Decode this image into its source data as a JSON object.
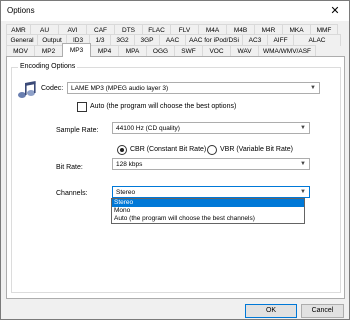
{
  "window": {
    "title": "Options",
    "close_glyph": "✕"
  },
  "tabs_row1": [
    "AMR",
    "AU",
    "AVI",
    "CAF",
    "DTS",
    "FLAC",
    "FLV",
    "M4A",
    "M4B",
    "M4R",
    "MKA",
    "MMF"
  ],
  "tabs_row2": [
    "General",
    "Output",
    "ID3",
    "1/3",
    "3G2",
    "3GP",
    "AAC",
    "AAC for iPod/DSi",
    "AC3",
    "AIFF",
    "ALAC"
  ],
  "tabs_row3": [
    "MOV",
    "MP2",
    "MP3",
    "MP4",
    "MPA",
    "OGG",
    "SWF",
    "VOC",
    "WAV",
    "WMA/WMV/ASF"
  ],
  "active_tab": "MP3",
  "encoding": {
    "group_label": "Encoding Options",
    "codec_label": "Codec:",
    "codec_value": "LAME MP3 (MPEG audio layer 3)",
    "auto_checkbox_label": "Auto (the program will choose the best options)",
    "sample_rate_label": "Sample Rate:",
    "sample_rate_value": "44100 Hz (CD quality)",
    "cbr_label": "CBR (Constant Bit Rate)",
    "vbr_label": "VBR (Variable Bit Rate)",
    "bitrate_label": "Bit Rate:",
    "bitrate_value": "128 kbps",
    "channels_label": "Channels:",
    "channels_value": "Stereo",
    "channels_options": [
      "Stereo",
      "Mono",
      "Auto (the program will choose the best channels)"
    ]
  },
  "buttons": {
    "ok": "OK",
    "cancel": "Cancel"
  },
  "icons": {
    "codec_icon": "music-notes-icon",
    "dropdown_arrow": "chevron-down-icon"
  },
  "colors": {
    "selection": "#0078d7"
  }
}
